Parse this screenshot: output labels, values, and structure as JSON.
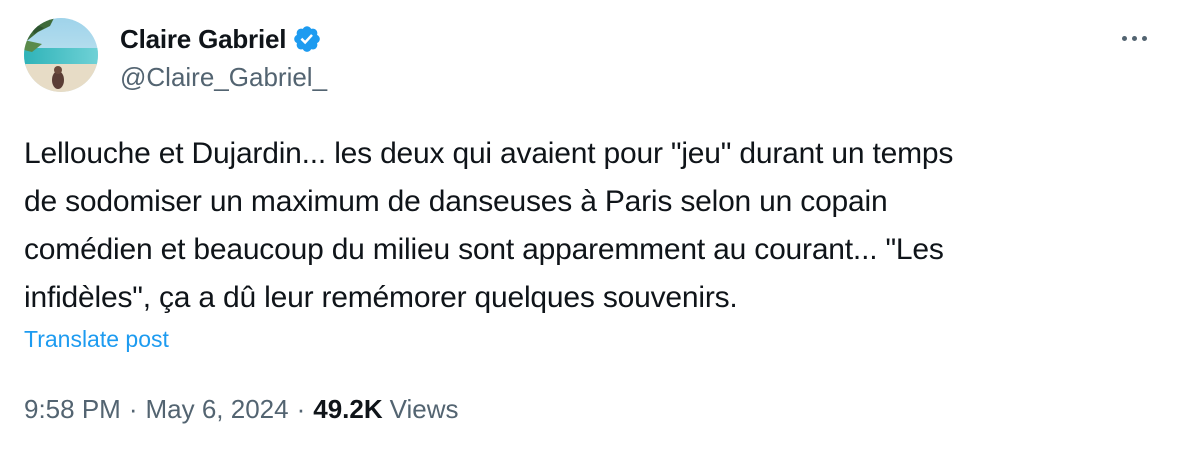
{
  "author": {
    "display_name": "Claire Gabriel",
    "handle": "@Claire_Gabriel_",
    "verified": true
  },
  "tweet": {
    "text_lines": [
      "Lellouche et Dujardin... les deux qui avaient pour \"jeu\" durant un temps",
      "de sodomiser un maximum de danseuses à Paris selon un copain",
      "comédien et beaucoup du milieu sont apparemment au courant... \"Les",
      "infidèles\", ça a dû leur remémorer quelques souvenirs."
    ],
    "translate_label": "Translate post",
    "time": "9:58 PM",
    "date": "May 6, 2024",
    "separator": "·",
    "views_count": "49.2K",
    "views_label": "Views"
  },
  "icons": {
    "verified": "verified-badge-icon",
    "more": "more-options-icon",
    "avatar": "beach-photo-avatar"
  },
  "colors": {
    "accent": "#1d9bf0",
    "text_primary": "#0f1419",
    "text_secondary": "#536471",
    "background": "#ffffff"
  }
}
